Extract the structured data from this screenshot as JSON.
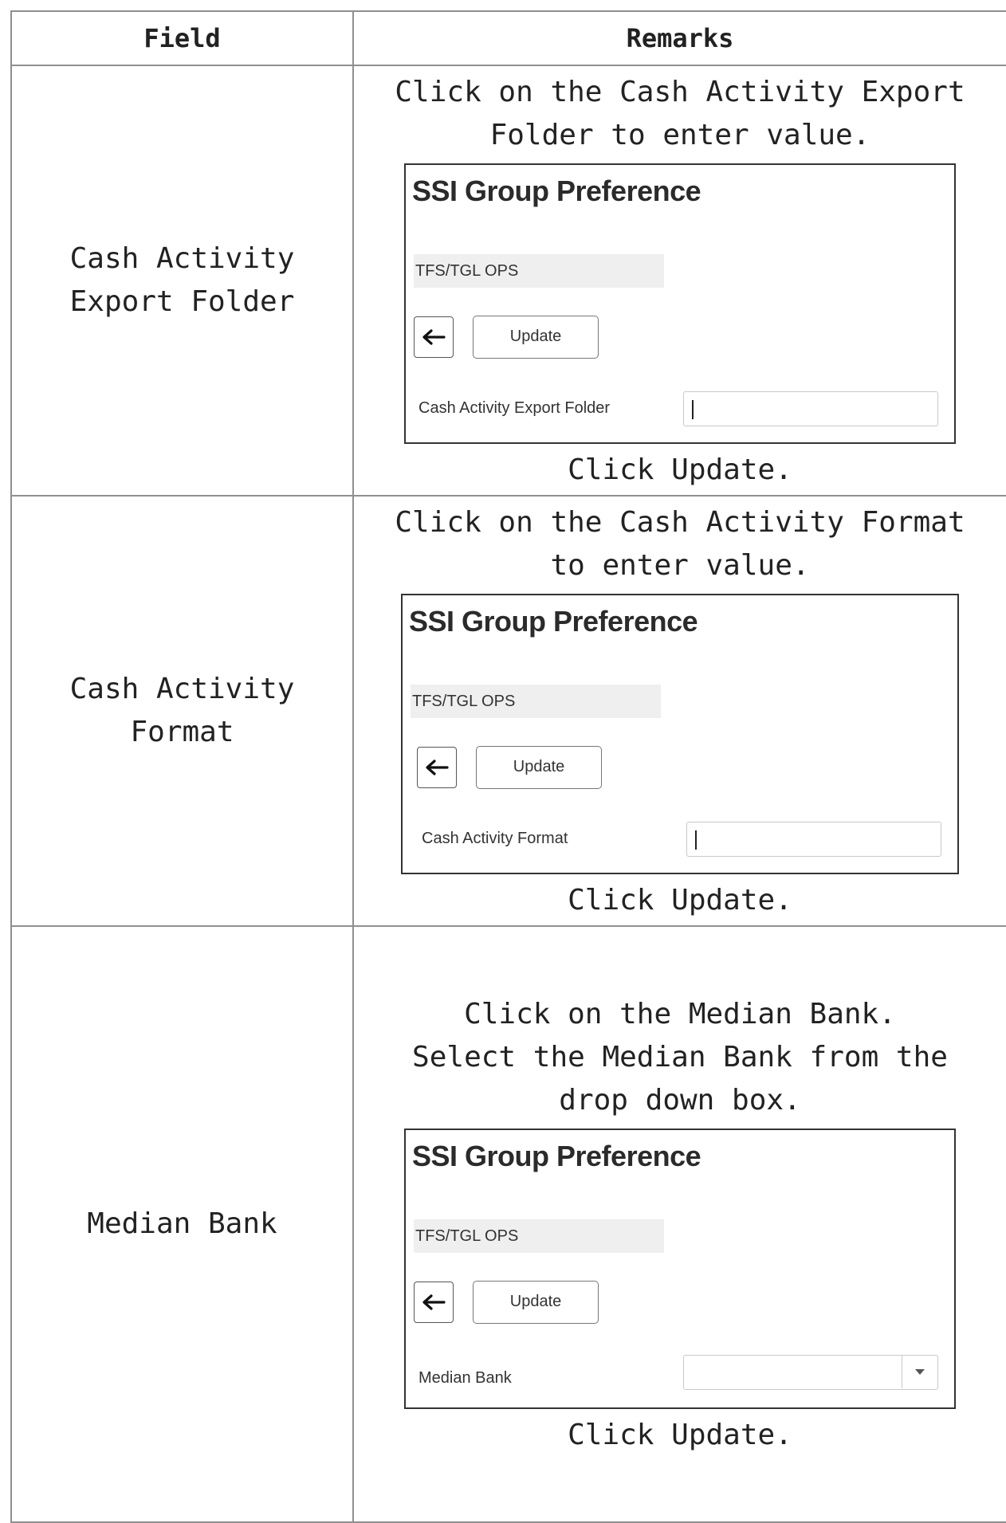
{
  "table": {
    "headers": {
      "field": "Field",
      "remarks": "Remarks"
    },
    "rows": [
      {
        "field": "Cash Activity Export Folder",
        "instruction_lines": [
          "Click on the Cash Activity Export",
          "Folder to enter value."
        ],
        "panel": {
          "title": "SSI Group Preference",
          "group": "TFS/TGL OPS",
          "update_label": "Update",
          "field_label": "Cash Activity Export Folder",
          "input_value": ""
        },
        "footer": "Click Update."
      },
      {
        "field": "Cash Activity Format",
        "instruction_lines": [
          "Click on the Cash Activity Format",
          "to enter value."
        ],
        "panel": {
          "title": "SSI Group Preference",
          "group": "TFS/TGL OPS",
          "update_label": "Update",
          "field_label": "Cash Activity Format",
          "input_value": ""
        },
        "footer": "Click Update."
      },
      {
        "field": "Median Bank",
        "instruction_lines": [
          "Click on the Median Bank.",
          "Select the Median Bank from the",
          "drop down box."
        ],
        "panel": {
          "title": "SSI Group Preference",
          "group": "TFS/TGL OPS",
          "update_label": "Update",
          "field_label": "Median Bank",
          "selected_value": ""
        },
        "footer": "Click Update."
      }
    ]
  },
  "icons": {
    "back": "arrow-left-icon",
    "dropdown": "chevron-down-icon"
  }
}
